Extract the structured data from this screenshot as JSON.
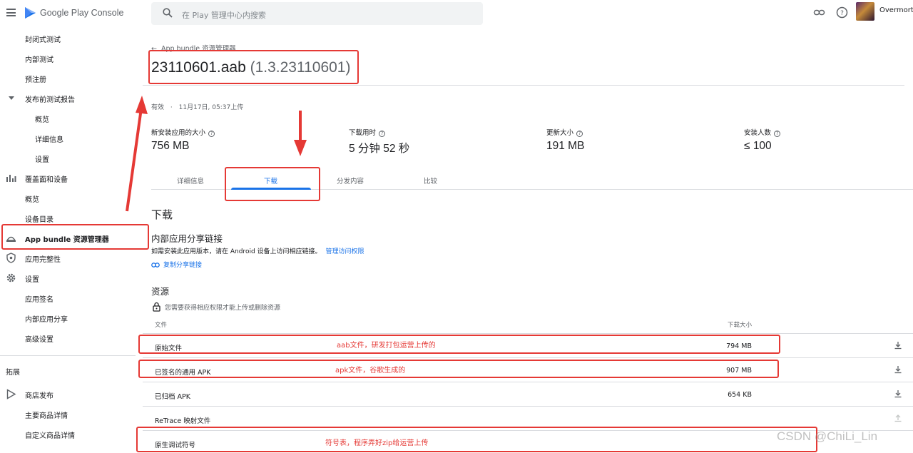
{
  "topbar": {
    "logo_text": "Google Play Console",
    "search_placeholder": "在 Play 管理中心内搜索",
    "user_name": "Overmorta"
  },
  "sidebar": {
    "items": [
      {
        "label": "封闭式测试",
        "level": 1
      },
      {
        "label": "内部测试",
        "level": 1
      },
      {
        "label": "预注册",
        "level": 1
      },
      {
        "label": "发布前测试报告",
        "level": 1
      },
      {
        "label": "概览",
        "level": 2
      },
      {
        "label": "详细信息",
        "level": 2
      },
      {
        "label": "设置",
        "level": 2
      },
      {
        "label": "覆盖面和设备",
        "level": 1
      },
      {
        "label": "概览",
        "level": 1
      },
      {
        "label": "设备目录",
        "level": 1
      },
      {
        "label": "App bundle 资源管理器",
        "level": 1
      },
      {
        "label": "应用完整性",
        "level": 1
      },
      {
        "label": "设置",
        "level": 1
      },
      {
        "label": "应用签名",
        "level": 1
      },
      {
        "label": "内部应用分享",
        "level": 1
      },
      {
        "label": "高级设置",
        "level": 1
      },
      {
        "label": "商店发布",
        "level": 1
      },
      {
        "label": "主要商品详情",
        "level": 1
      },
      {
        "label": "自定义商品详情",
        "level": 1
      }
    ],
    "section_label": "拓展"
  },
  "main": {
    "back_label": "App bundle 资源管理器",
    "title_main": "23110601.aab",
    "title_version": "(1.3.23110601)",
    "status": "有效",
    "uploaded": "11月17日, 05:37上传",
    "stats": [
      {
        "label": "新安装应用的大小",
        "value": "756 MB"
      },
      {
        "label": "下载用时",
        "value": "5 分钟 52 秒"
      },
      {
        "label": "更新大小",
        "value": "191 MB"
      },
      {
        "label": "安装人数",
        "value": "≤ 100"
      }
    ],
    "tabs": [
      "详细信息",
      "下载",
      "分发内容",
      "比较"
    ],
    "active_tab": "下载",
    "download_heading": "下载",
    "share_heading": "内部应用分享链接",
    "share_desc": "如需安装此应用版本，请在 Android 设备上访问相应链接。",
    "manage_access": "管理访问权限",
    "copy_share_link": "复制分享链接",
    "resources_heading": "资源",
    "permission_note": "您需要获得相应权限才能上传或删除资源",
    "table": {
      "col_file": "文件",
      "col_size": "下载大小",
      "rows": [
        {
          "name": "原始文件",
          "size": "794 MB"
        },
        {
          "name": "已签名的通用 APK",
          "size": "907 MB"
        },
        {
          "name": "已归档 APK",
          "size": "654 KB"
        },
        {
          "name": "ReTrace 映射文件",
          "size": ""
        },
        {
          "name": "原生调试符号",
          "size": ""
        }
      ]
    }
  },
  "annotations": {
    "note_aab": "aab文件，研发打包运营上传的",
    "note_apk": "apk文件，谷歌生成的",
    "note_symbols": "符号表，程序弄好zip给运营上传",
    "color": "#e53935"
  },
  "watermark": "CSDN @ChiLi_Lin",
  "colors": {
    "accent": "#1a73e8",
    "annotation": "#e53935"
  }
}
